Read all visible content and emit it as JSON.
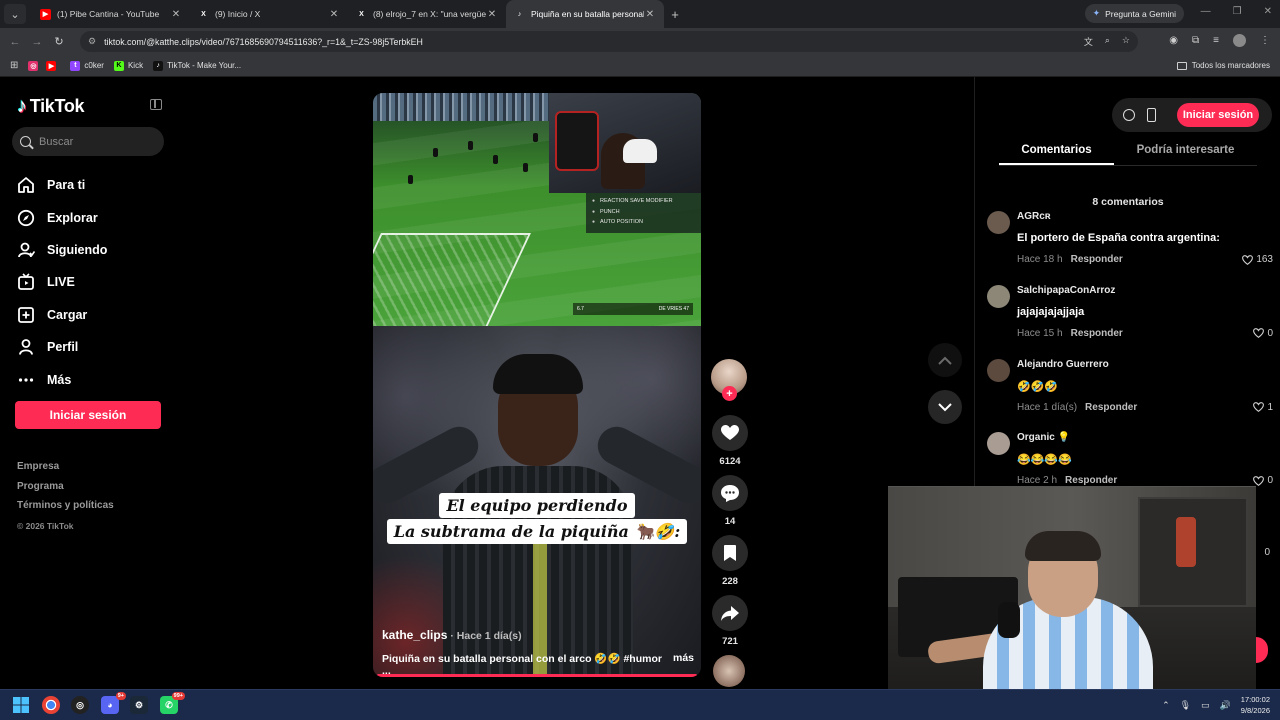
{
  "browser": {
    "tabs": [
      {
        "title": "(1) Pibe Cantina - YouTube",
        "favicon": "youtube-icon",
        "color": "#ff0000",
        "active": false
      },
      {
        "title": "(9) Inicio / X",
        "favicon": "x-icon",
        "color": "#ffffff",
        "active": false
      },
      {
        "title": "(8) elrojo_7 en X: \"una vergüen",
        "favicon": "x-icon",
        "color": "#ffffff",
        "active": false
      },
      {
        "title": "Piquiña en su batalla personal c",
        "favicon": "tiktok-icon",
        "color": "#ffffff",
        "active": true
      }
    ],
    "gemini_label": "Pregunta a Gemini",
    "url": "tiktok.com/@katthe.clips/video/7671685690794511636?_r=1&_t=ZS-98j5TerbkEH",
    "bookmarks": [
      {
        "label": "",
        "icon": "instagram-icon",
        "color": "#e1306c"
      },
      {
        "label": "",
        "icon": "youtube-icon",
        "color": "#ff0000"
      },
      {
        "label": "c0ker",
        "icon": "twitch-icon",
        "color": "#9146ff"
      },
      {
        "label": "Kick",
        "icon": "kick-icon",
        "color": "#53fc18"
      },
      {
        "label": "TikTok - Make Your...",
        "icon": "tiktok-icon",
        "color": "#ffffff"
      }
    ],
    "all_bookmarks": "Todos los marcadores"
  },
  "tiktok": {
    "logo": "TikTok",
    "search_placeholder": "Buscar",
    "nav": [
      {
        "label": "Para ti",
        "icon": "home-icon"
      },
      {
        "label": "Explorar",
        "icon": "compass-icon"
      },
      {
        "label": "Siguiendo",
        "icon": "following-icon"
      },
      {
        "label": "LIVE",
        "icon": "live-icon"
      },
      {
        "label": "Cargar",
        "icon": "upload-icon"
      },
      {
        "label": "Perfil",
        "icon": "profile-icon"
      },
      {
        "label": "Más",
        "icon": "more-icon"
      }
    ],
    "login_label": "Iniciar sesión",
    "footer": [
      "Empresa",
      "Programa",
      "Términos y políticas"
    ],
    "copyright": "© 2026 TikTok",
    "accent": "#fe2c55"
  },
  "video": {
    "game_hud": [
      "REACTION SAVE MODIFIER",
      "PUNCH",
      "AUTO POSITION"
    ],
    "score_left": "6.7",
    "score_right": "DE VRIES 47",
    "caption_line1": "El equipo perdiendo",
    "caption_line2": "La subtrama de la piquiña 🐂🤣:",
    "author": "kathe_clips",
    "date": "· Hace 1 día(s)",
    "description": "Piquiña en su batalla personal con el arco 🤣🤣 #humor ...",
    "more": "más",
    "likes": "6124",
    "comments": "14",
    "saves": "228",
    "shares": "721"
  },
  "panel": {
    "login_label": "Iniciar sesión",
    "tab_comments": "Comentarios",
    "tab_related": "Podría interesarte",
    "count": "8 comentarios",
    "comments": [
      {
        "user": "AGRcʀ",
        "text": "El portero de España contra argentina:",
        "time": "Hace 18 h",
        "reply": "Responder",
        "likes": "163"
      },
      {
        "user": "SalchipapaConArroz",
        "text": "jajajajajajjaja",
        "time": "Hace 15 h",
        "reply": "Responder",
        "likes": "0"
      },
      {
        "user": "Alejandro Guerrero",
        "text": "🤣🤣🤣",
        "time": "Hace 1 día(s)",
        "reply": "Responder",
        "likes": "1"
      },
      {
        "user": "Organic 💡",
        "text": "😂😂😂😂",
        "time": "Hace 2 h",
        "reply": "Responder",
        "likes": "0"
      }
    ],
    "hidden_like": "0"
  },
  "taskbar": {
    "discord_badge": "9+",
    "whatsapp_badge": "99+",
    "time": "17:00:02",
    "date": "9/8/2026"
  }
}
